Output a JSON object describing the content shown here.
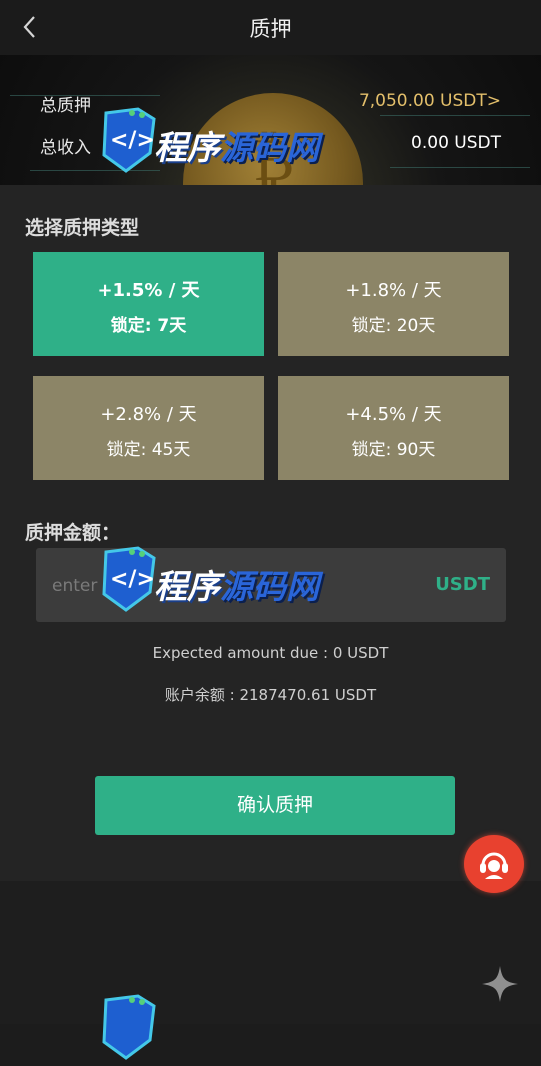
{
  "header": {
    "title": "质押"
  },
  "summary": {
    "total_stake_label": "总质押",
    "total_stake_value": "7,050.00 USDT>",
    "total_income_label": "总收入",
    "total_income_value": "0.00 USDT"
  },
  "plans_section": {
    "title": "选择质押类型",
    "plans": [
      {
        "rate": "+1.5% / 天",
        "lock": "锁定: 7天"
      },
      {
        "rate": "+1.8% / 天",
        "lock": "锁定: 20天"
      },
      {
        "rate": "+2.8% / 天",
        "lock": "锁定: 45天"
      },
      {
        "rate": "+4.5% / 天",
        "lock": "锁定: 90天"
      }
    ]
  },
  "amount_section": {
    "title": "质押金额：",
    "placeholder": "enter",
    "unit": "USDT",
    "expected": "Expected amount due : 0 USDT",
    "balance": "账户余额 : 2187470.61 USDT"
  },
  "confirm_label": "确认质押",
  "watermark": {
    "text_white": "程序",
    "text_blue": "源码网"
  },
  "colors": {
    "accent": "#2fb088",
    "plan_default": "#8c8567",
    "gold": "#e3bf6b",
    "support": "#e8412f"
  },
  "icons": {
    "back": "chevron-left-icon",
    "support": "customer-service-icon",
    "sparkle": "sparkle-icon"
  }
}
